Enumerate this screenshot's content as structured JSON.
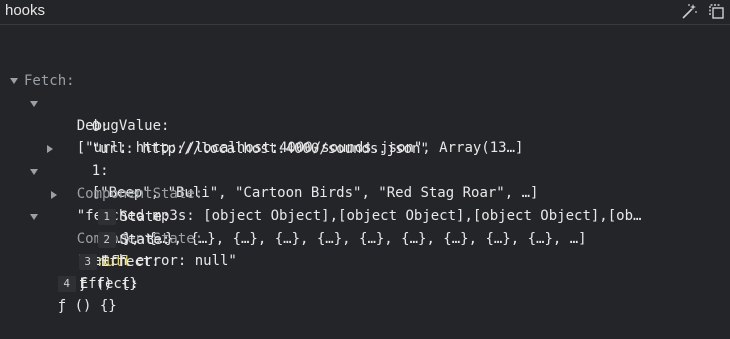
{
  "header": {
    "title": "hooks",
    "icons": [
      "magic-wand-icon",
      "inspect-element-icon"
    ]
  },
  "tree": {
    "fetch": {
      "label": "Fetch:"
    },
    "debug_value": {
      "key": "DebugValue:",
      "value": "[\"url: http://localhost:4000/sounds.json\", Array(13…]",
      "item0_key": "0:",
      "item0_value": "\"url: http://localhost:4000/sounds.json\"",
      "item1_key": "1:",
      "item1_value": "[\"Beep\", \"Buli\", \"Cartoon Birds\", \"Red Stag Roar\", …]"
    },
    "component_state_1": {
      "key": "ComponentState:",
      "value": "\"fetched mp3s: [object Object],[object Object],[object Object],[ob…",
      "state_badge": "1",
      "state_key": "State:",
      "state_value": "[{…}, {…}, {…}, {…}, {…}, {…}, {…}, {…}, {…}, {…}, {…}, …]"
    },
    "component_state_2": {
      "key": "ComponentState:",
      "value": "\"fetch error: null\"",
      "state_badge": "2",
      "state_key": "State:",
      "state_value": "null"
    },
    "effect_3": {
      "badge": "3",
      "key": "Effect:",
      "value": "ƒ () {}"
    },
    "effect_4": {
      "badge": "4",
      "key": "Effect:",
      "value": "ƒ () {}"
    }
  }
}
